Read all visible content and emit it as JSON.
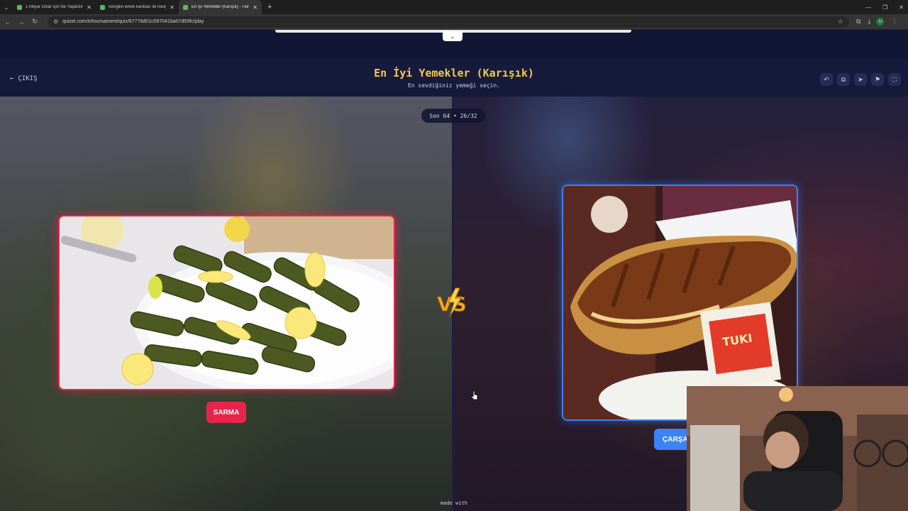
{
  "browser": {
    "tabs": [
      {
        "label": "1 Milyar Dolar için Ne Yapardın",
        "active": false
      },
      {
        "label": "Sevgilin erkek kankası ile hangi",
        "active": false
      },
      {
        "label": "En İyi Yemekler (Karışık) - Tier Li",
        "active": true
      }
    ],
    "url": "quizei.com/tr/tournament/quiz/67778d01c097041ba07d59fc/play"
  },
  "header": {
    "exit_label": "ÇIKIŞ",
    "title": "En İyi Yemekler (Karışık)",
    "subtitle": "En sevdiğiniz yemeği seçin.",
    "icons": [
      "undo-icon",
      "share-icon",
      "send-icon",
      "flag-icon",
      "fullscreen-icon"
    ]
  },
  "match": {
    "round_label": "Son 64 • 26/32",
    "left_choice": "SARMA",
    "right_choice": "ÇARŞAF",
    "vs_label": "VS"
  },
  "footer": {
    "made_with": "made with"
  },
  "colors": {
    "accent_title": "#f5c84c",
    "left_accent": "#e8244a",
    "right_accent": "#3b82f6",
    "header_bg": "#161b3d"
  }
}
